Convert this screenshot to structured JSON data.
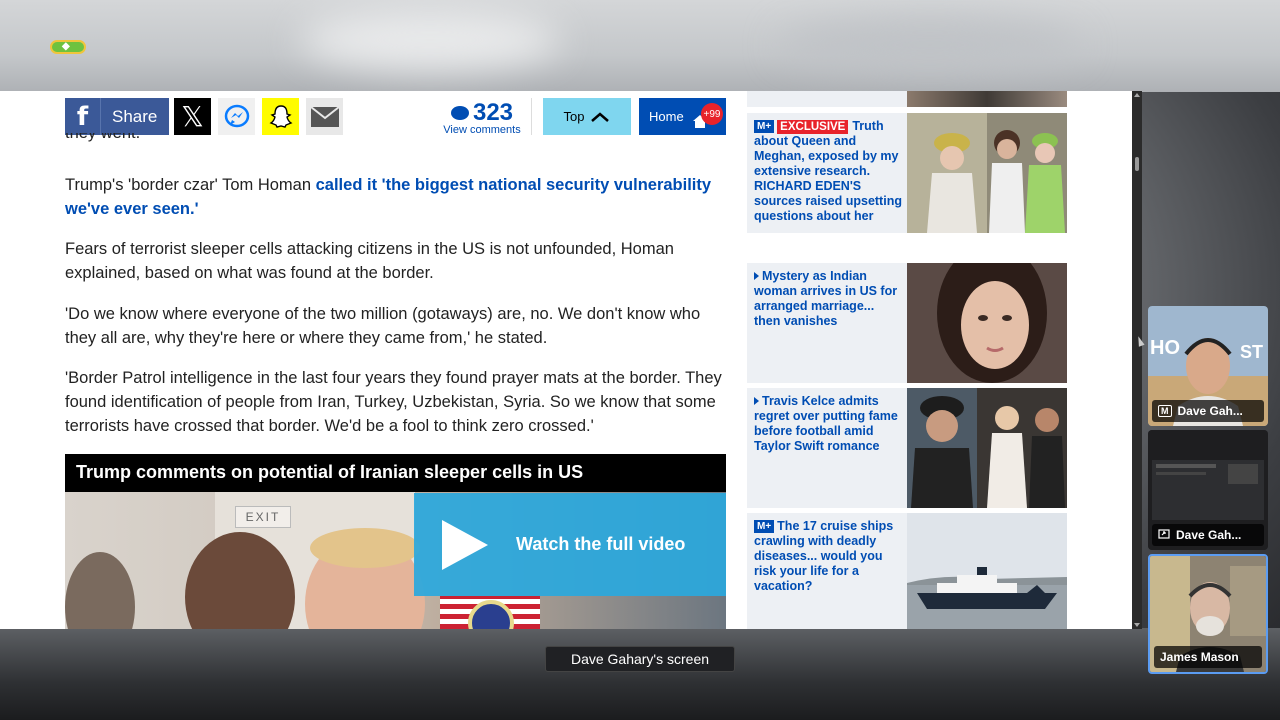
{
  "meeting": {
    "screen_label": "Dave Gahary's screen",
    "participants": [
      {
        "name": "Dave Gah...",
        "icon": "m-badge-icon"
      },
      {
        "name": "Dave Gah...",
        "icon": "screen-share-icon"
      },
      {
        "name": "James Mason",
        "icon": ""
      }
    ]
  },
  "sharebar": {
    "facebook_label": "Share",
    "comments_count": "323",
    "comments_sub": "View comments",
    "top_label": "Top",
    "home_label": "Home",
    "home_badge": "+99"
  },
  "article": {
    "cutoff": "they went.",
    "p1_plain": "Trump's 'border czar' Tom Homan ",
    "p1_link": "called it 'the biggest national security vulnerability we've ever seen.'",
    "p2": "Fears of terrorist sleeper cells attacking citizens in the US is not unfounded, Homan explained, based on what was found at the border.",
    "p3": "'Do we know where everyone of the two million (gotaways) are, no. We don't know who they all are, why they're here or where they came from,' he stated.",
    "p4": "'Border Patrol intelligence in the last four years they found prayer mats at the border. They found identification of people from Iran, Turkey, Uzbekistan, Syria. So we know that some terrorists have crossed that border. We'd be a fool to think zero crossed.'"
  },
  "video": {
    "title": "Trump comments on potential of Iranian sleeper cells in US",
    "watch_label": "Watch the full video",
    "exit_sign": "EXIT"
  },
  "sidebar": {
    "cards": [
      {
        "badge": "M+",
        "exclusive": "EXCLUSIVE",
        "text": "Truth about Queen and Meghan, exposed by my extensive research. RICHARD EDEN'S sources raised upsetting questions about her"
      },
      {
        "badge": "",
        "exclusive": "",
        "text": "Mystery as Indian woman arrives in US for arranged marriage... then vanishes"
      },
      {
        "badge": "",
        "exclusive": "",
        "text": "Travis Kelce admits regret over putting fame before football amid Taylor Swift romance"
      },
      {
        "badge": "M+",
        "exclusive": "",
        "text": "The 17 cruise ships crawling with deadly diseases... would you risk your life for a vacation?"
      }
    ]
  },
  "colors": {
    "link_blue": "#004db3",
    "facebook_blue": "#3b5998",
    "top_cyan": "#7fd6ef",
    "badge_red": "#e8232b",
    "watch_cyan": "#2aa8dd",
    "sidebar_bg": "#edf0f4"
  }
}
